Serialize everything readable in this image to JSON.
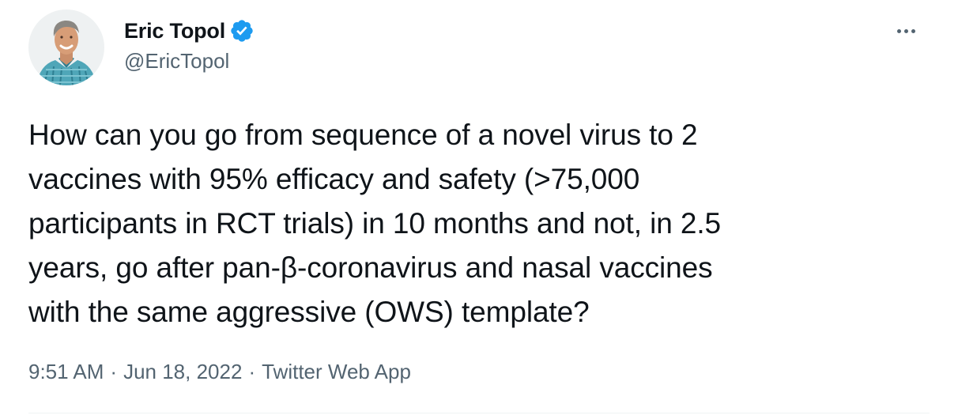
{
  "author": {
    "display_name": "Eric Topol",
    "handle": "@EricTopol",
    "verified": true,
    "avatar_icon": "profile-photo"
  },
  "more_menu": {
    "icon": "more-horizontal-icon"
  },
  "tweet": {
    "text": "How can you go from sequence of a novel virus to 2\nvaccines with 95% efficacy and safety (>75,000\nparticipants in RCT trials) in 10 months and not, in 2.5\nyears, go after pan-β-coronavirus and nasal vaccines\nwith the same aggressive (OWS) template?"
  },
  "meta": {
    "time": "9:51 AM",
    "date": "Jun 18, 2022",
    "source": "Twitter Web App",
    "separator": "·"
  },
  "colors": {
    "text_primary": "#0f1419",
    "text_secondary": "#536471",
    "verified_blue": "#1d9bf0",
    "divider": "#eff3f4"
  }
}
